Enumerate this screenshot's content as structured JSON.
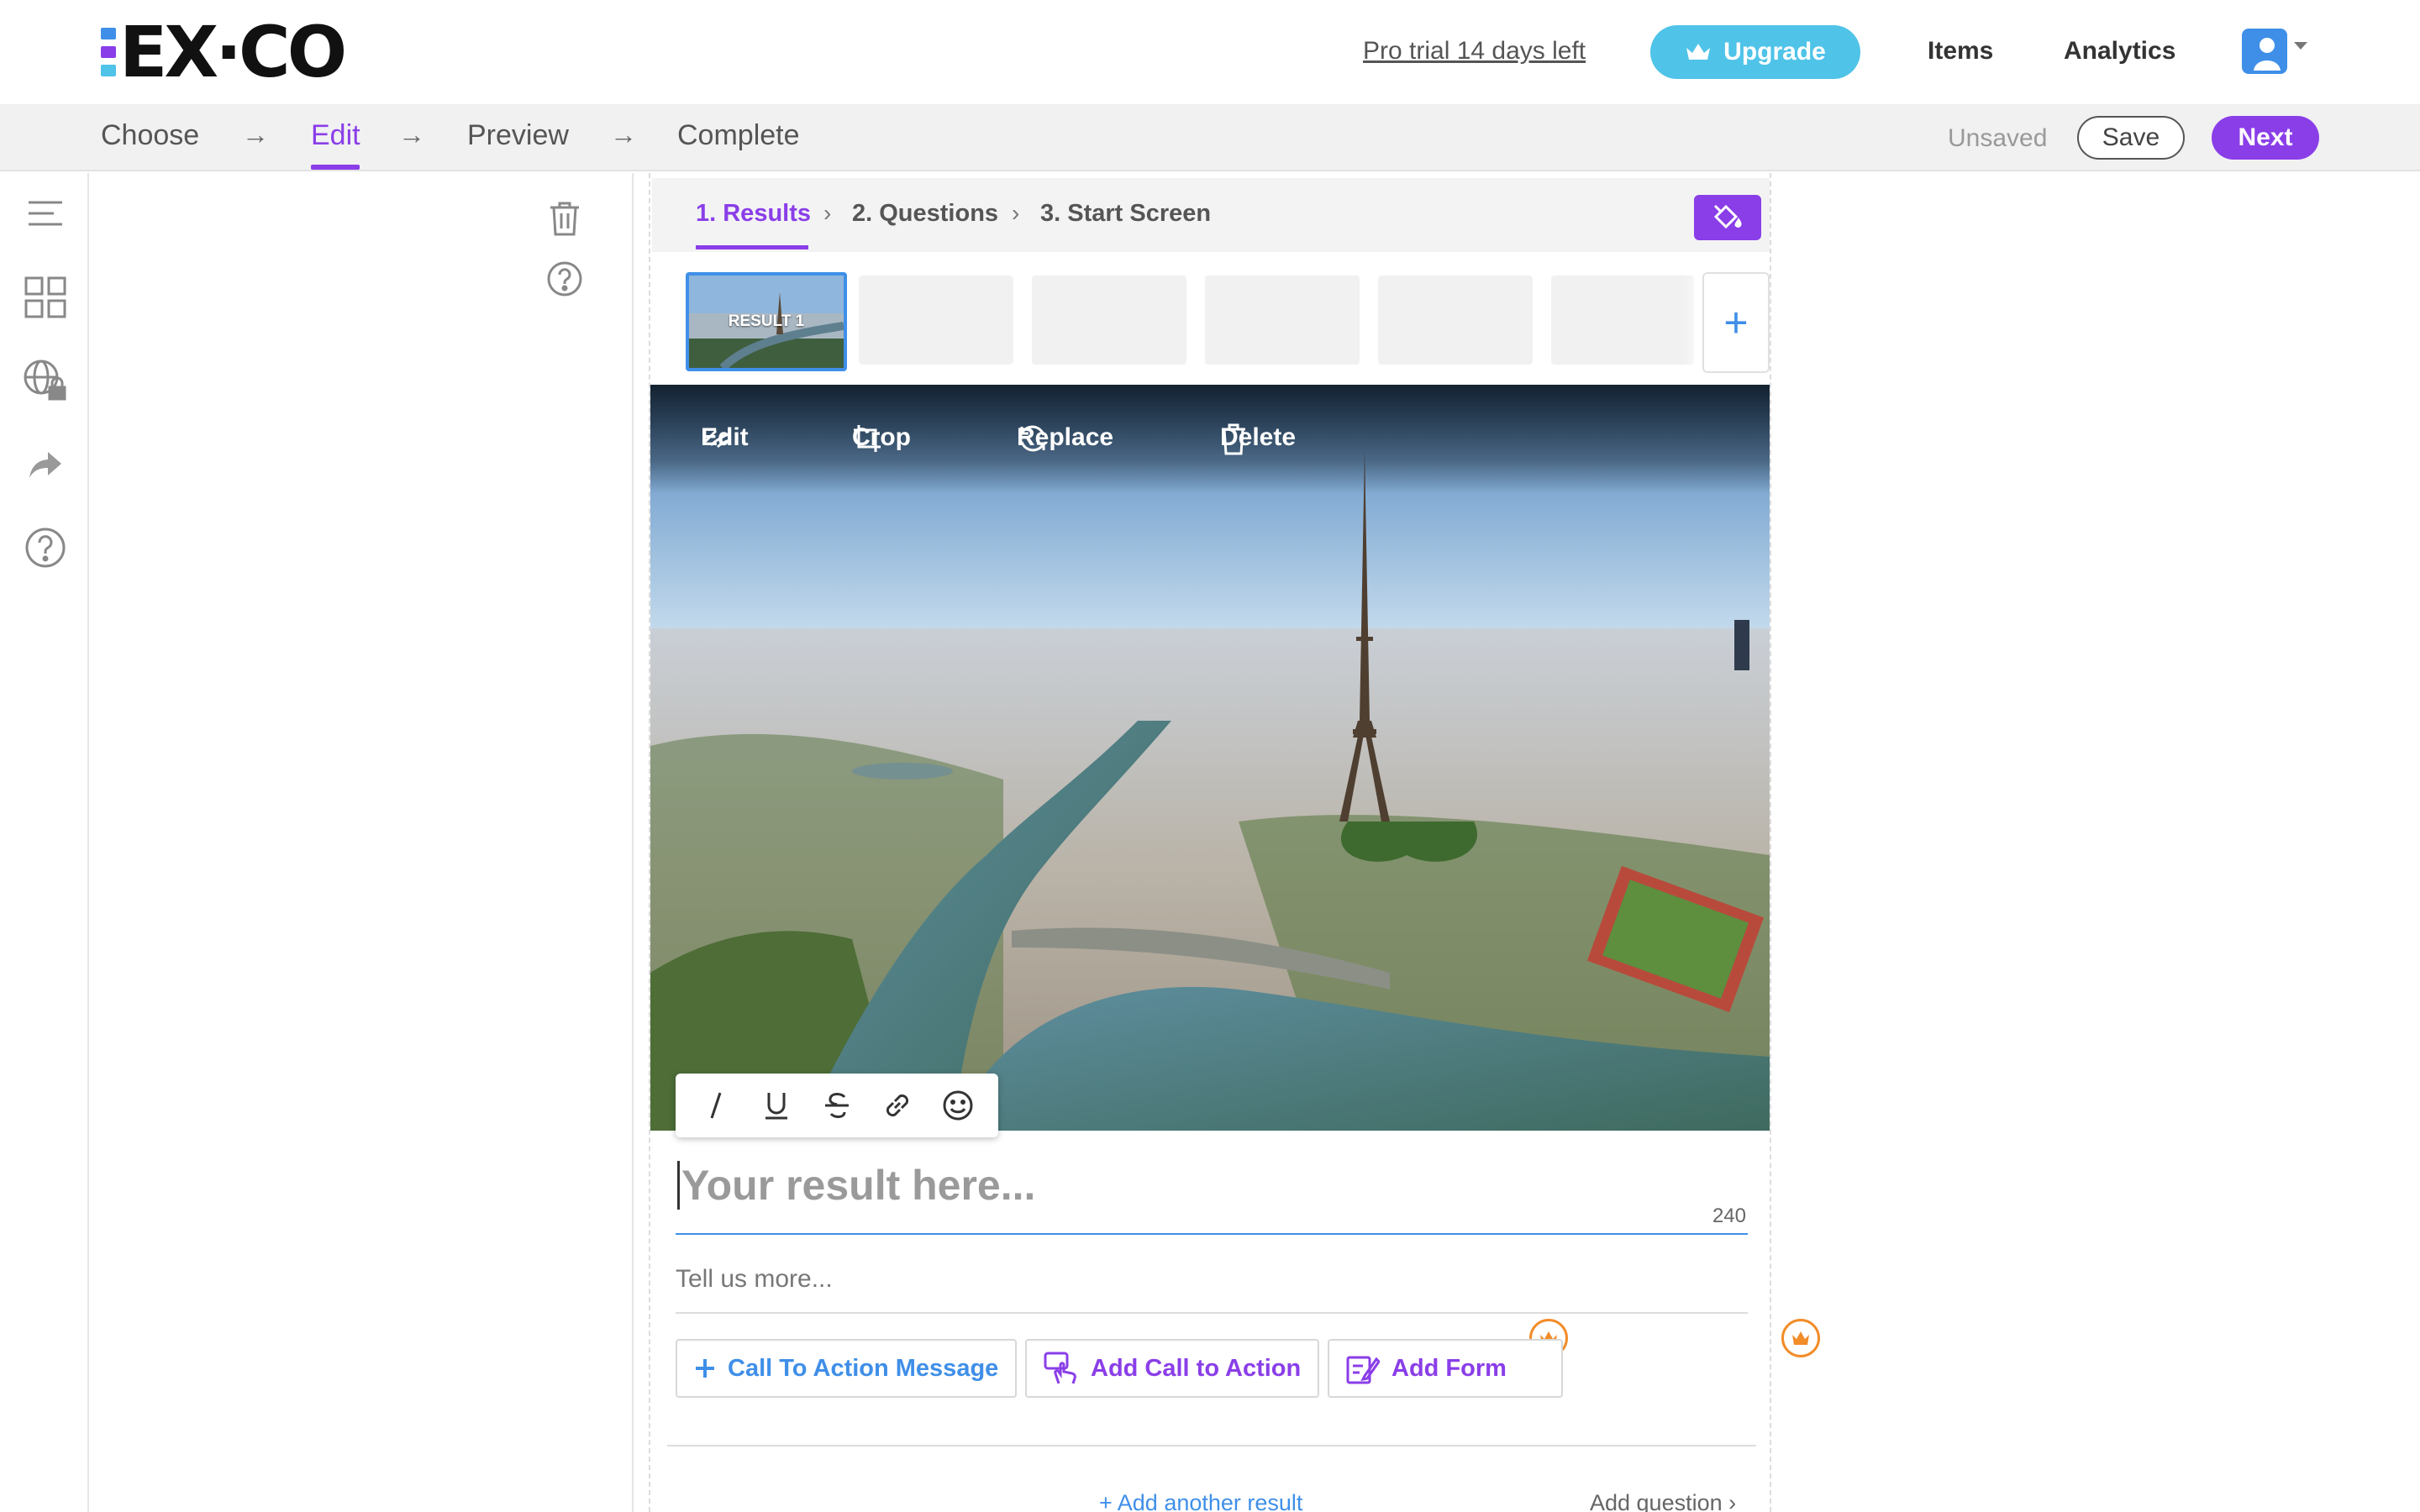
{
  "app": {
    "logo_text": "EX·CO",
    "logo_colors": [
      "#3f8fe8",
      "#8a3ee8",
      "#4fc3e8"
    ],
    "accent_color": "#8a3ee8",
    "link_color": "#3f8fe8"
  },
  "header": {
    "trial_text": "Pro trial 14 days left",
    "upgrade_label": "Upgrade",
    "nav": [
      {
        "label": "Items"
      },
      {
        "label": "Analytics"
      }
    ],
    "avatar_icon": "user-avatar-icon"
  },
  "stepper": {
    "steps": [
      {
        "label": "Choose"
      },
      {
        "label": "Edit"
      },
      {
        "label": "Preview"
      },
      {
        "label": "Complete"
      }
    ],
    "arrow": "→",
    "active_step": "Edit",
    "status": "Unsaved",
    "save_label": "Save",
    "next_label": "Next"
  },
  "left_rail": {
    "icons": [
      "menu-icon",
      "grid-icon",
      "globe-lock-icon",
      "share-icon",
      "help-icon"
    ]
  },
  "left_panel": {
    "icons": [
      "trash-icon",
      "help-icon"
    ]
  },
  "editor": {
    "tabs": [
      {
        "label": "1. Results"
      },
      {
        "label": "2. Questions"
      },
      {
        "label": "3. Start Screen"
      }
    ],
    "active_tab": "1. Results",
    "thumbnails": {
      "selected_label": "RESULT 1",
      "add_symbol": "+"
    },
    "image_toolbar": [
      {
        "label": "Edit",
        "icon": "magic-wand-icon"
      },
      {
        "label": "Crop",
        "icon": "crop-icon"
      },
      {
        "label": "Replace",
        "icon": "refresh-icon"
      },
      {
        "label": "Delete",
        "icon": "trash-icon"
      }
    ],
    "format_buttons": [
      "italic-icon",
      "underline-icon",
      "strikethrough-icon",
      "link-icon",
      "emoji-icon"
    ],
    "result_placeholder": "Your result here...",
    "char_count": "240",
    "description_placeholder": "Tell us more...",
    "actions": [
      {
        "label": "Call To Action Message",
        "icon": "plus-icon",
        "pro": false
      },
      {
        "label": "Add Call to Action",
        "icon": "pointer-hand-icon",
        "pro": true
      },
      {
        "label": "Add Form",
        "icon": "form-edit-icon",
        "pro": true
      }
    ],
    "add_result_label": "+ Add another result",
    "add_question_label": "Add question",
    "add_question_chevron": "›"
  }
}
